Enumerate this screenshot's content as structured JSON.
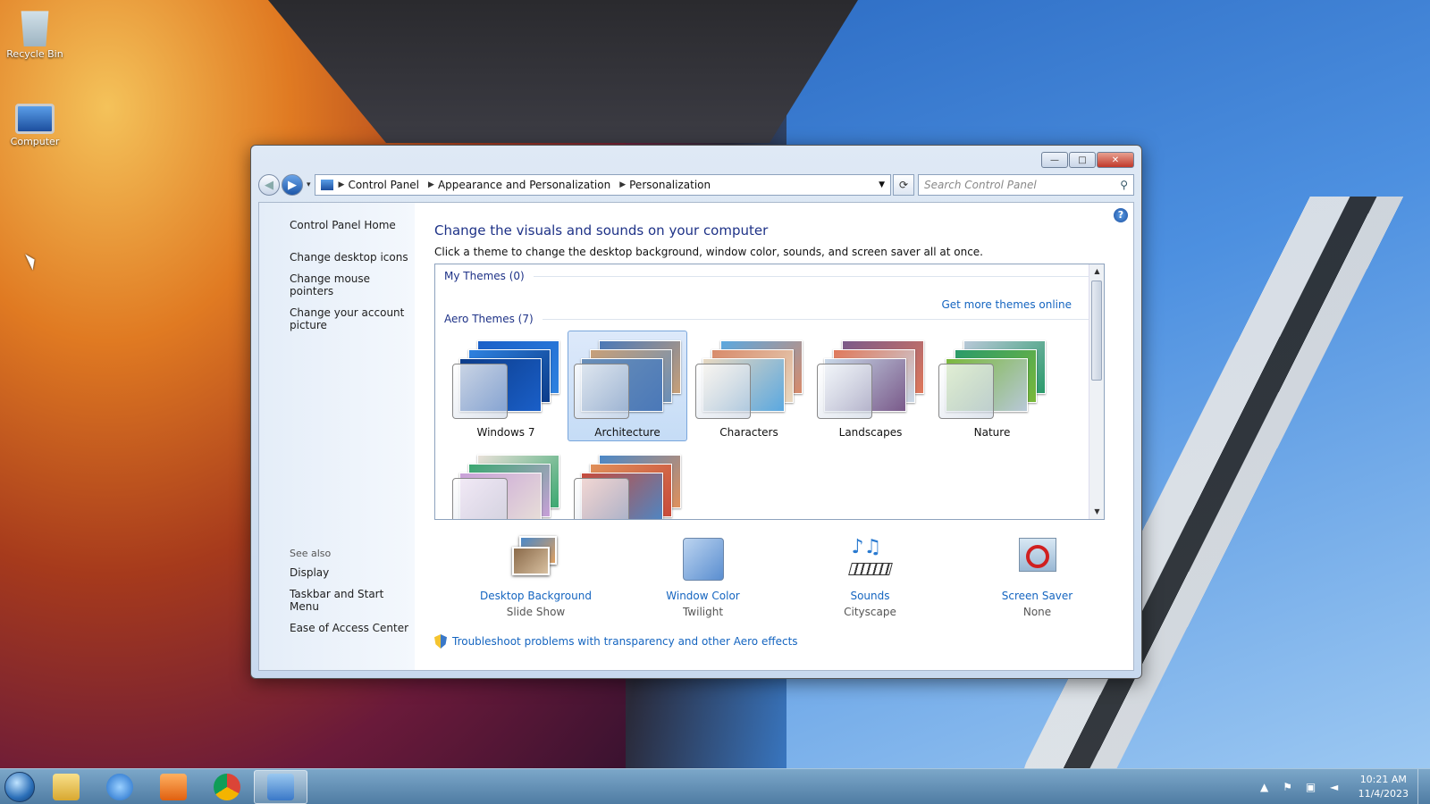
{
  "desktop": {
    "icons": [
      {
        "label": "Recycle Bin",
        "icon": "recycle-bin-icon"
      },
      {
        "label": "Computer",
        "icon": "computer-icon"
      }
    ]
  },
  "window": {
    "caption_buttons": {
      "minimize": "—",
      "maximize": "□",
      "close": "✕"
    },
    "nav": {
      "back": "◀",
      "forward": "▶",
      "history": "▾"
    },
    "breadcrumbs": [
      "Control Panel",
      "Appearance and Personalization",
      "Personalization"
    ],
    "search_placeholder": "Search Control Panel",
    "help": "?"
  },
  "left_pane": {
    "home": "Control Panel Home",
    "tasks": [
      "Change desktop icons",
      "Change mouse pointers",
      "Change your account picture"
    ],
    "see_also_title": "See also",
    "see_also": [
      "Display",
      "Taskbar and Start Menu",
      "Ease of Access Center"
    ]
  },
  "main": {
    "heading": "Change the visuals and sounds on your computer",
    "intro": "Click a theme to change the desktop background, window color, sounds, and screen saver all at once.",
    "my_themes_title": "My Themes (0)",
    "get_more": "Get more themes online",
    "aero_title": "Aero Themes (7)",
    "themes": [
      {
        "label": "Windows 7",
        "selected": false,
        "colors": [
          "#1a5fc8",
          "#2e82e0",
          "#0c3c8a"
        ]
      },
      {
        "label": "Architecture",
        "selected": true,
        "colors": [
          "#4a78b8",
          "#c8a078",
          "#6a8fb8"
        ]
      },
      {
        "label": "Characters",
        "selected": false,
        "colors": [
          "#5aa8e0",
          "#d88a6a",
          "#e8d8c0"
        ]
      },
      {
        "label": "Landscapes",
        "selected": false,
        "colors": [
          "#7a5a8a",
          "#e0785a",
          "#c8d8e8"
        ]
      },
      {
        "label": "Nature",
        "selected": false,
        "colors": [
          "#b8c8d8",
          "#2a9a6a",
          "#7ab83a"
        ]
      }
    ],
    "themes_row2": [
      {
        "label": "",
        "colors": [
          "#e8e0d8",
          "#3aa870",
          "#c8a0d8"
        ]
      },
      {
        "label": "",
        "colors": [
          "#4a88c8",
          "#e0905a",
          "#c84a3a"
        ]
      }
    ],
    "tiles": [
      {
        "label": "Desktop Background",
        "sub": "Slide Show",
        "icon": "desktop-background-icon"
      },
      {
        "label": "Window Color",
        "sub": "Twilight",
        "icon": "window-color-icon"
      },
      {
        "label": "Sounds",
        "sub": "Cityscape",
        "icon": "sounds-icon"
      },
      {
        "label": "Screen Saver",
        "sub": "None",
        "icon": "screen-saver-icon"
      }
    ],
    "troubleshoot": "Troubleshoot problems with transparency and other Aero effects"
  },
  "taskbar": {
    "pinned": [
      "windows-explorer-icon",
      "internet-explorer-icon",
      "media-player-icon",
      "chrome-icon",
      "control-panel-icon"
    ],
    "clock_time": "10:21 AM",
    "clock_date": "11/4/2023"
  }
}
